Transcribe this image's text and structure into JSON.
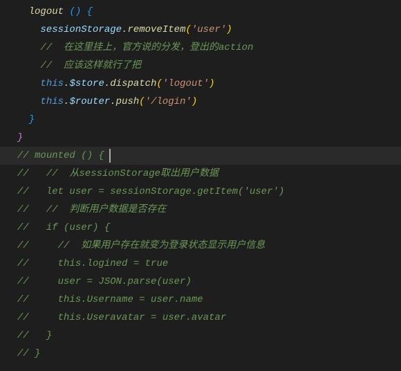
{
  "code": {
    "l1": {
      "indent": "    ",
      "fn": "logout",
      "sp": " ",
      "lp": "(",
      "rp": ")",
      "sp2": " ",
      "ob": "{"
    },
    "l2": {
      "indent": "      ",
      "v1": "sessionStorage",
      "dot": ".",
      "fn": "removeItem",
      "lp": "(",
      "s": "'user'",
      "rp": ")"
    },
    "l3": {
      "indent": "      ",
      "c": "// ​ 在这里挂上，官方说的分发，登出的action"
    },
    "l4": {
      "indent": "      ",
      "c": "// ​ 应该这样就行了把"
    },
    "l5": {
      "indent": "      ",
      "kw": "this",
      "dot1": ".",
      "v1": "$store",
      "dot2": ".",
      "fn": "dispatch",
      "lp": "(",
      "s": "'logout'",
      "rp": ")"
    },
    "l6": {
      "indent": "      ",
      "kw": "this",
      "dot1": ".",
      "v1": "$router",
      "dot2": ".",
      "fn": "push",
      "lp": "(",
      "s": "'/login'",
      "rp": ")"
    },
    "l7": {
      "indent": "    ",
      "cb": "}"
    },
    "l8": {
      "indent": "  ",
      "cb": "}"
    },
    "l9": {
      "indent": "  ",
      "c": "// mounted () {"
    },
    "l10": {
      "indent": "  ",
      "c": "//   // ​ 从sessionStorage取出用户数据"
    },
    "l11": {
      "indent": "  ",
      "c": "//   let user = sessionStorage.getItem('user')"
    },
    "l12": {
      "indent": "  ",
      "c": "//   // ​ 判断用户数据是否存在"
    },
    "l13": {
      "indent": "  ",
      "c": "//   if (user) {"
    },
    "l14": {
      "indent": "  ",
      "c": "//     // ​ 如果用户存在就变为登录状态显示用户信息"
    },
    "l15": {
      "indent": "  ",
      "c": "//     this.logined = true"
    },
    "l16": {
      "indent": "  ",
      "c": "//     user = JSON.parse(user)"
    },
    "l17": {
      "indent": "  ",
      "c": "//     this.Username = user.name"
    },
    "l18": {
      "indent": "  ",
      "c": "//     this.Useravatar = user.avatar"
    },
    "l19": {
      "indent": "  ",
      "c": "//   }"
    },
    "l20": {
      "indent": "  ",
      "c": "// }"
    }
  }
}
